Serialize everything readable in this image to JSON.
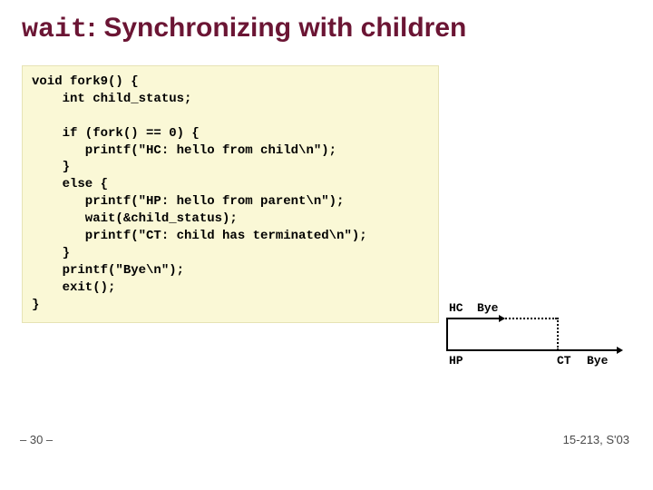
{
  "title": {
    "mono": "wait",
    "rest": ": Synchronizing with children"
  },
  "code": "void fork9() {\n    int child_status;\n\n    if (fork() == 0) {\n       printf(\"HC: hello from child\\n\");\n    }\n    else {\n       printf(\"HP: hello from parent\\n\");\n       wait(&child_status);\n       printf(\"CT: child has terminated\\n\");\n    }\n    printf(\"Bye\\n\");\n    exit();\n}",
  "graph": {
    "hc": "HC",
    "bye1": "Bye",
    "hp": "HP",
    "ct": "CT",
    "bye2": "Bye"
  },
  "footer": {
    "page": "– 30 –",
    "course": "15-213, S'03"
  }
}
